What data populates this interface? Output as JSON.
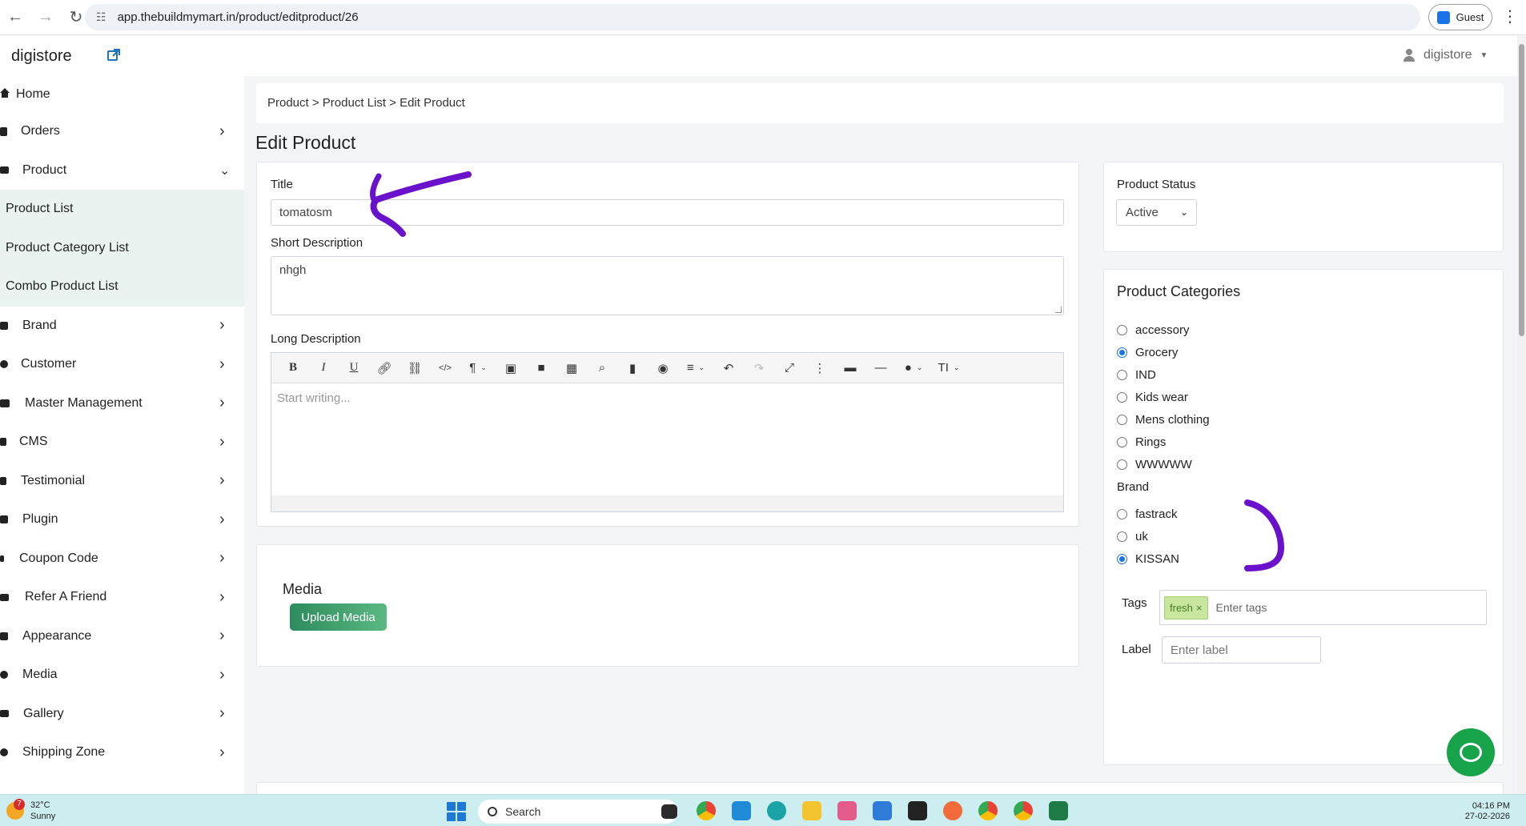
{
  "browser": {
    "url": "app.thebuildmymart.in/product/editproduct/26",
    "guest_label": "Guest"
  },
  "header": {
    "store_name": "digistore",
    "user_name": "digistore"
  },
  "sidebar": {
    "items": [
      {
        "label": "Home",
        "icon": "home-icon"
      },
      {
        "label": "Orders",
        "icon": "orders-icon"
      },
      {
        "label": "Product",
        "icon": "product-icon"
      },
      {
        "label": "Brand",
        "icon": "brand-icon"
      },
      {
        "label": "Customer",
        "icon": "customer-icon"
      },
      {
        "label": "Master Management",
        "icon": "master-icon"
      },
      {
        "label": "CMS",
        "icon": "cms-icon"
      },
      {
        "label": "Testimonial",
        "icon": "testimonial-icon"
      },
      {
        "label": "Plugin",
        "icon": "plugin-icon"
      },
      {
        "label": "Coupon Code",
        "icon": "coupon-icon"
      },
      {
        "label": "Refer A Friend",
        "icon": "refer-icon"
      },
      {
        "label": "Appearance",
        "icon": "appearance-icon"
      },
      {
        "label": "Media",
        "icon": "media-icon"
      },
      {
        "label": "Gallery",
        "icon": "gallery-icon"
      },
      {
        "label": "Shipping Zone",
        "icon": "shipping-icon"
      }
    ],
    "product_sub": [
      "Product List",
      "Product Category List",
      "Combo Product List"
    ]
  },
  "breadcrumb": "Product > Product List > Edit Product",
  "page_title": "Edit Product",
  "form": {
    "title_label": "Title",
    "title_value": "tomatosm",
    "short_desc_label": "Short Description",
    "short_desc_value": "nhgh",
    "long_desc_label": "Long Description",
    "editor_placeholder": "Start writing..."
  },
  "media": {
    "heading": "Media",
    "upload_label": "Upload Media"
  },
  "status": {
    "label": "Product Status",
    "value": "Active"
  },
  "categories": {
    "heading": "Product Categories",
    "items": [
      "accessory",
      "Grocery",
      "IND",
      "Kids wear",
      "Mens clothing",
      "Rings",
      "WWWWW"
    ],
    "selected": "Grocery"
  },
  "brand": {
    "label": "Brand",
    "items": [
      "fastrack",
      "uk",
      "KISSAN"
    ],
    "selected": "KISSAN"
  },
  "tags": {
    "label": "Tags",
    "chips": [
      "fresh"
    ],
    "placeholder": "Enter tags"
  },
  "label_field": {
    "label": "Label",
    "placeholder": "Enter label"
  },
  "taskbar": {
    "temperature": "32°C",
    "condition": "Sunny",
    "badge": "7",
    "search": "Search",
    "time": "04:16 PM",
    "date": "27-02-2026"
  },
  "colors": {
    "accent_green": "#2e8b5e",
    "annotation_purple": "#6a11cb",
    "radio_blue": "#1a73e8"
  }
}
